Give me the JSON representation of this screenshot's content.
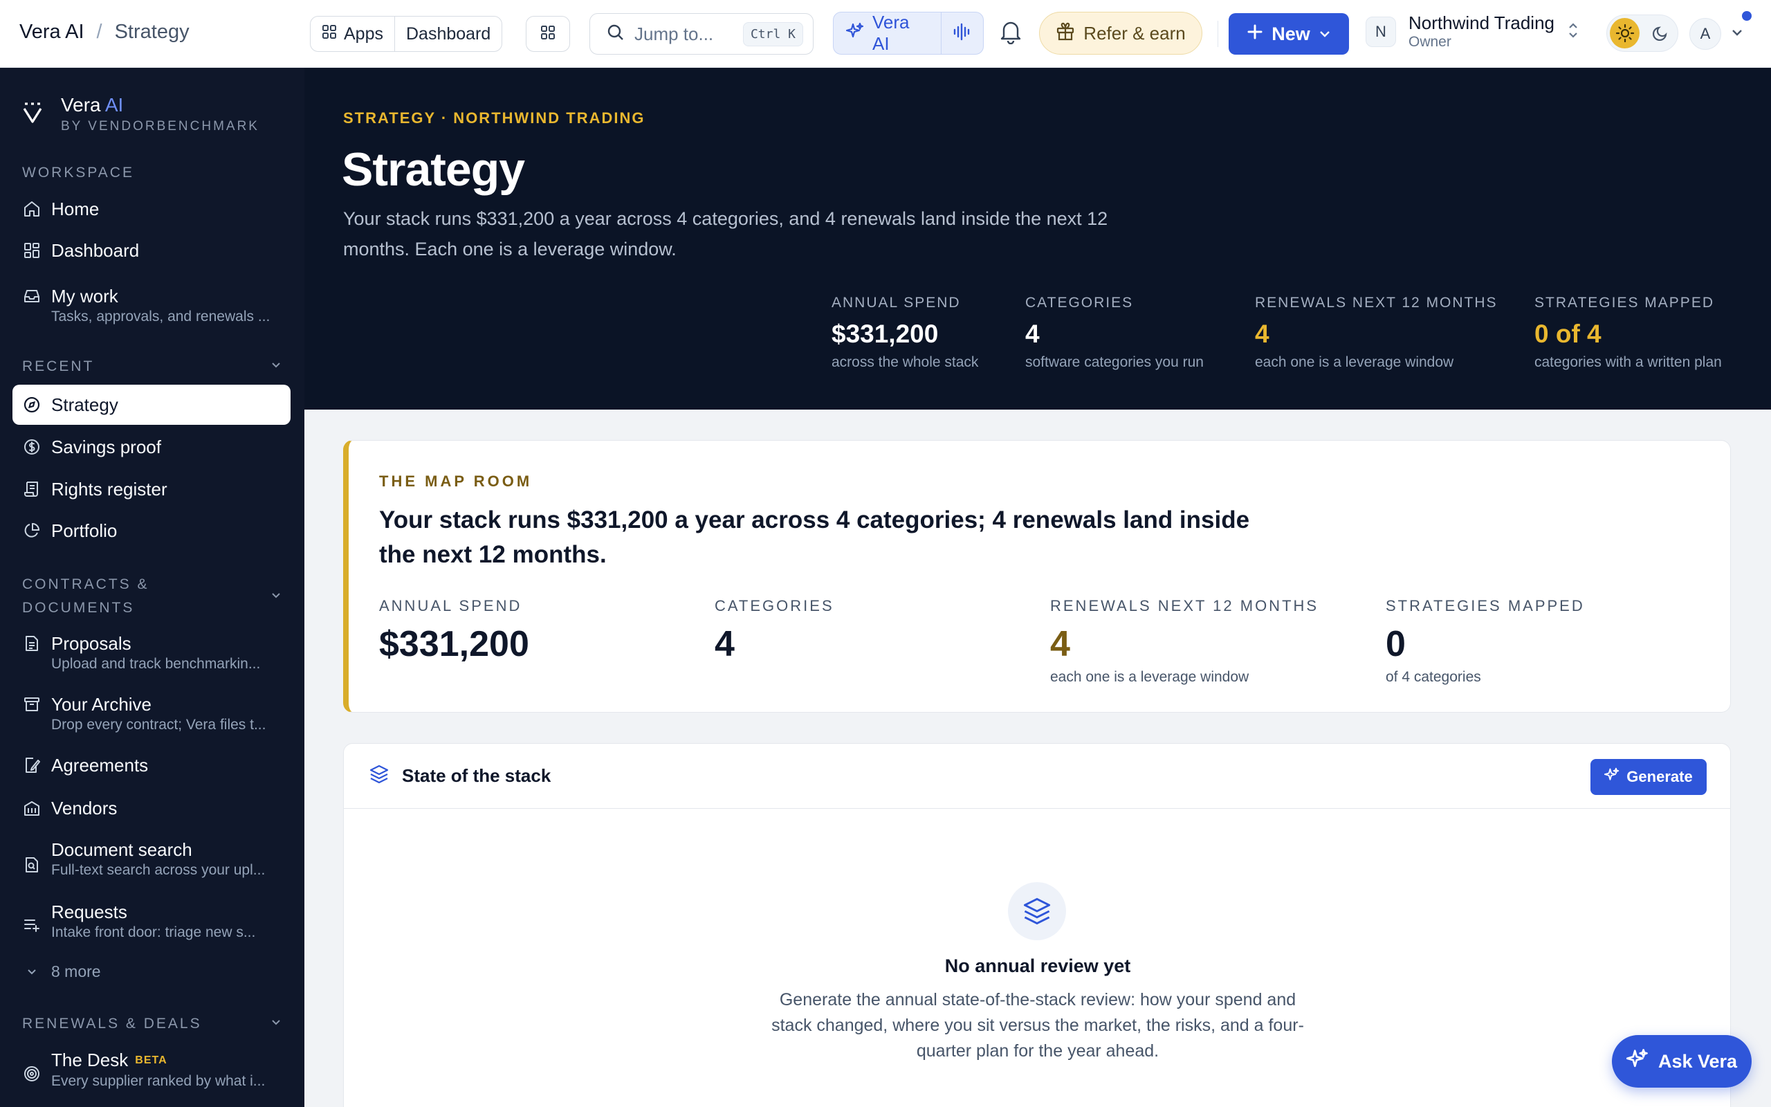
{
  "breadcrumb": {
    "root": "Vera AI",
    "separator": "/",
    "current": "Strategy"
  },
  "topbar": {
    "apps_label": "Apps",
    "dashboard_label": "Dashboard",
    "search_placeholder": "Jump to...",
    "search_shortcut": "Ctrl K",
    "vera_label": "Vera AI",
    "refer_label": "Refer & earn",
    "new_label": "New",
    "org_badge": "N",
    "org_name": "Northwind Trading",
    "org_role": "Owner",
    "avatar_initial": "A"
  },
  "sidebar": {
    "brand_name": "Vera",
    "brand_accent": "AI",
    "brand_sub": "BY VENDORBENCHMARK",
    "workspace_title": "WORKSPACE",
    "workspace": [
      {
        "label": "Home",
        "sub": ""
      },
      {
        "label": "Dashboard",
        "sub": ""
      },
      {
        "label": "My work",
        "sub": "Tasks, approvals, and renewals ..."
      }
    ],
    "recent_title": "RECENT",
    "recent": [
      {
        "label": "Strategy"
      },
      {
        "label": "Savings proof"
      },
      {
        "label": "Rights register"
      },
      {
        "label": "Portfolio"
      }
    ],
    "contracts_title_1": "CONTRACTS &",
    "contracts_title_2": "DOCUMENTS",
    "contracts": [
      {
        "label": "Proposals",
        "sub": "Upload and track benchmarkin..."
      },
      {
        "label": "Your Archive",
        "sub": "Drop every contract; Vera files t..."
      },
      {
        "label": "Agreements",
        "sub": ""
      },
      {
        "label": "Vendors",
        "sub": ""
      },
      {
        "label": "Document search",
        "sub": "Full-text search across your upl..."
      },
      {
        "label": "Requests",
        "sub": "Intake front door: triage new s..."
      }
    ],
    "more_label": "8 more",
    "renewals_title": "RENEWALS & DEALS",
    "desk_label": "The Desk",
    "desk_badge": "BETA",
    "desk_sub": "Every supplier ranked by what i..."
  },
  "hero": {
    "eyebrow": "STRATEGY · NORTHWIND TRADING",
    "title": "Strategy",
    "description": "Your stack runs $331,200 a year across 4 categories, and 4 renewals land inside the next 12 months. Each one is a leverage window.",
    "stats": [
      {
        "key": "ANNUAL SPEND",
        "value": "$331,200",
        "sub": "across the whole stack"
      },
      {
        "key": "CATEGORIES",
        "value": "4",
        "sub": "software categories you run"
      },
      {
        "key": "RENEWALS NEXT 12 MONTHS",
        "value": "4",
        "sub": "each one is a leverage window"
      },
      {
        "key": "STRATEGIES MAPPED",
        "value": "0 of 4",
        "sub": "categories with a written plan"
      }
    ]
  },
  "maproom": {
    "eyebrow": "THE MAP ROOM",
    "headline": "Your stack runs $331,200 a year across 4 categories; 4 renewals land inside the next 12 months.",
    "stats": [
      {
        "key": "ANNUAL SPEND",
        "value": "$331,200",
        "sub": ""
      },
      {
        "key": "CATEGORIES",
        "value": "4",
        "sub": ""
      },
      {
        "key": "RENEWALS NEXT 12 MONTHS",
        "value": "4",
        "sub": "each one is a leverage window"
      },
      {
        "key": "STRATEGIES MAPPED",
        "value": "0",
        "sub": "of 4 categories"
      }
    ]
  },
  "stack": {
    "title": "State of the stack",
    "generate_label": "Generate",
    "empty_title": "No annual review yet",
    "empty_desc": "Generate the annual state-of-the-stack review: how your spend and stack changed, where you sit versus the market, the risks, and a four-quarter plan for the year ahead."
  },
  "ask_label": "Ask Vera",
  "colors": {
    "accent": "#2f56d9",
    "gold": "#e9b72f",
    "navy": "#0f172a"
  }
}
